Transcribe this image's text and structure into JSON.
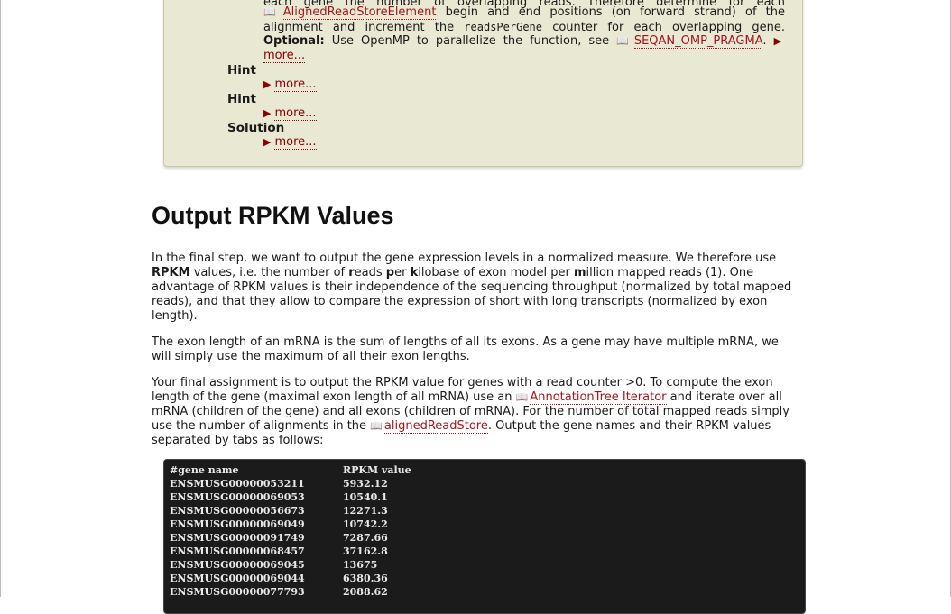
{
  "assignment": {
    "line0": "each gene the number of overlapping reads. Therefore determine for each",
    "line1_link": "AlignedReadStoreElement",
    "line1_rest": "begin and end positions (on forward strand) of the",
    "line2_a": "alignment and increment the",
    "line2_code": "readsPerGene",
    "line2_b": "counter for each overlapping gene.",
    "line3_bold": "Optional:",
    "line3_text": "Use OpenMP to parallelize the function, see",
    "line3_link": "SEQAN_OMP_PRAGMA",
    "more_label": "more...",
    "hint1": "Hint",
    "hint2": "Hint",
    "solution": "Solution"
  },
  "section": {
    "title": "Output RPKM Values",
    "p1": {
      "l1": "In the final step, we want to output the gene expression levels in a normalized measure. We therefore use",
      "l2_a": "RPKM",
      "l2_b": " values, i.e. the number of ",
      "l2_r": "r",
      "l2_c": "eads ",
      "l2_p": "p",
      "l2_d": "er ",
      "l2_k": "k",
      "l2_e": "ilobase of exon model per ",
      "l2_m": "m",
      "l2_f": "illion mapped reads (1). One",
      "l3": "advantage of RPKM values is their independence of the sequencing throughput (normalized by total mapped",
      "l4": "reads), and that they allow to compare the expression of short with long transcripts (normalized by exon",
      "l5": "length)."
    },
    "p2": {
      "l1": "The exon length of an mRNA is the sum of lengths of all its exons. As a gene may have multiple mRNA, we",
      "l2": "will simply use the maximum of all their exon lengths."
    },
    "p3": {
      "l1": "Your final assignment is to output the RPKM value for genes with a read counter >0. To compute the exon",
      "l2_a": "length of the gene (maximal exon length of all mRNA) use an",
      "l2_link": "AnnotationTree Iterator",
      "l2_b": "and iterate over all",
      "l3": "mRNA (children of the gene) and all exons (children of mRNA). For the number of total mapped reads simply",
      "l4_a": "use the number of alignments in the",
      "l4_link": "alignedReadStore",
      "l4_b": ". Output the gene names and their RPKM values",
      "l5": "separated by tabs as follows:"
    }
  },
  "code_output": {
    "header": [
      "#gene name",
      "RPKM value"
    ],
    "rows": [
      [
        "ENSMUSG00000053211",
        "5932.12"
      ],
      [
        "ENSMUSG00000069053",
        "10540.1"
      ],
      [
        "ENSMUSG00000056673",
        "12271.3"
      ],
      [
        "ENSMUSG00000069049",
        "10742.2"
      ],
      [
        "ENSMUSG00000091749",
        "7287.66"
      ],
      [
        "ENSMUSG00000068457",
        "37162.8"
      ],
      [
        "ENSMUSG00000069045",
        "13675"
      ],
      [
        "ENSMUSG00000069044",
        "6380.36"
      ],
      [
        "ENSMUSG00000077793",
        "2088.62"
      ]
    ]
  },
  "colors": {
    "box_bg": "#e8e8d3",
    "link": "#a3161d",
    "code_bg": "#1b1b1b"
  }
}
